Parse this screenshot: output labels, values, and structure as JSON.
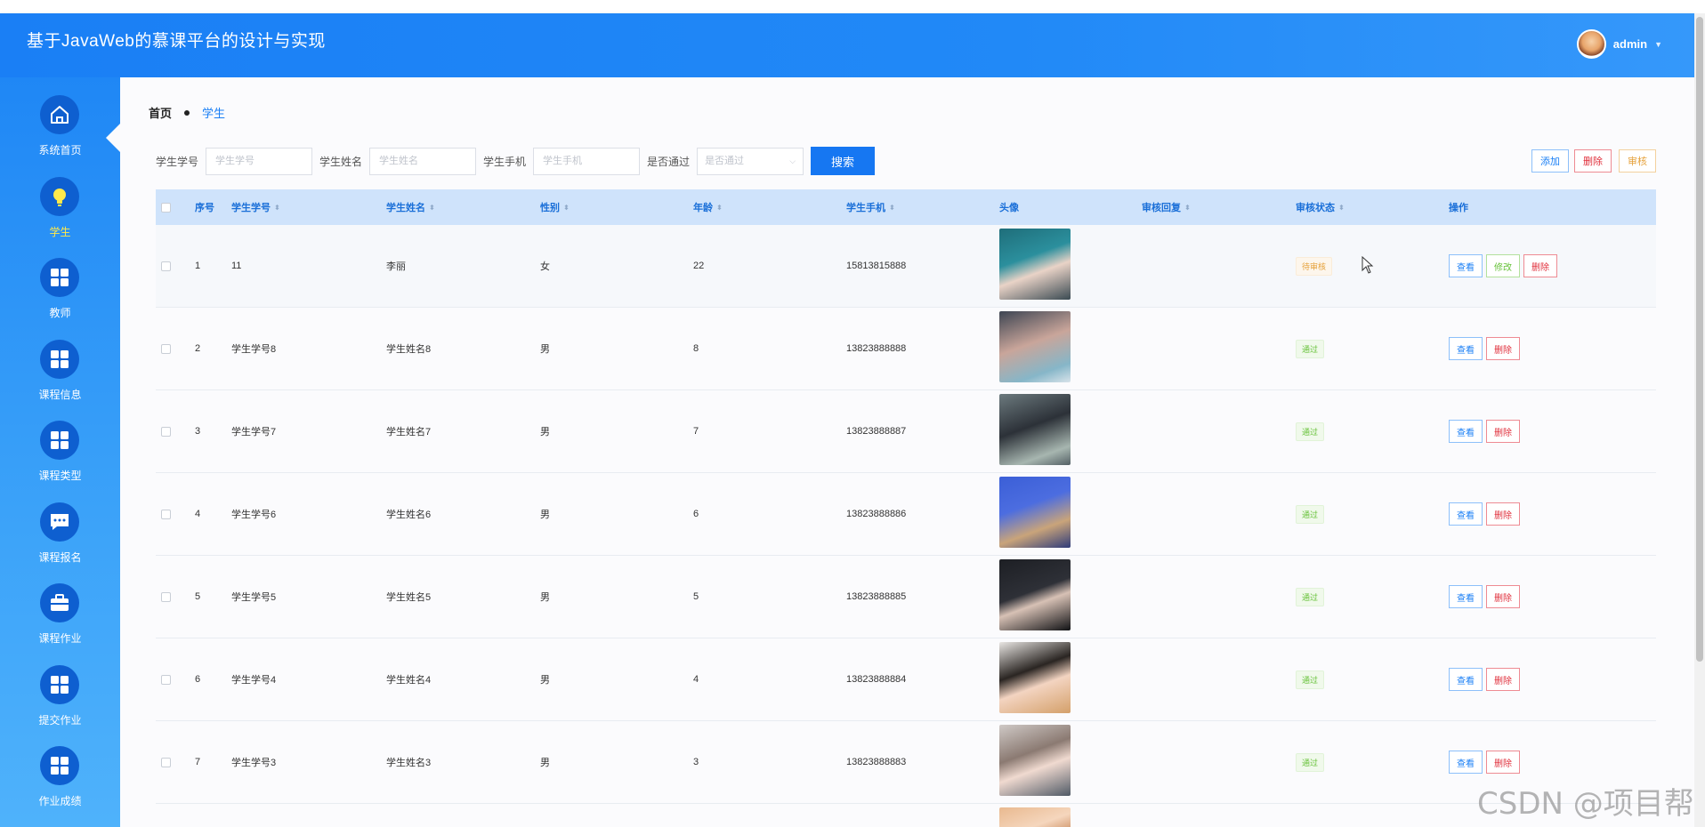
{
  "app": {
    "title": "基于JavaWeb的慕课平台的设计与实现",
    "user": "admin"
  },
  "sidebar": {
    "items": [
      {
        "label": "系统首页",
        "icon": "home-icon"
      },
      {
        "label": "学生",
        "icon": "lightbulb-icon",
        "active": true
      },
      {
        "label": "教师",
        "icon": "grid-icon"
      },
      {
        "label": "课程信息",
        "icon": "grid-icon"
      },
      {
        "label": "课程类型",
        "icon": "grid-icon"
      },
      {
        "label": "课程报名",
        "icon": "chat-icon"
      },
      {
        "label": "课程作业",
        "icon": "briefcase-icon"
      },
      {
        "label": "提交作业",
        "icon": "grid-icon"
      },
      {
        "label": "作业成绩",
        "icon": "grid-icon"
      }
    ]
  },
  "breadcrumb": {
    "home": "首页",
    "current": "学生"
  },
  "search": {
    "fields": [
      {
        "label": "学生学号",
        "placeholder": "学生学号"
      },
      {
        "label": "学生姓名",
        "placeholder": "学生姓名"
      },
      {
        "label": "学生手机",
        "placeholder": "学生手机"
      }
    ],
    "select": {
      "label": "是否通过",
      "placeholder": "是否通过"
    },
    "button": "搜索"
  },
  "toolbar": {
    "add": "添加",
    "delete": "删除",
    "audit": "审核"
  },
  "table": {
    "headers": {
      "index": "序号",
      "sno": "学生学号",
      "name": "学生姓名",
      "gender": "性别",
      "age": "年龄",
      "phone": "学生手机",
      "avatar": "头像",
      "reply": "审核回复",
      "status": "审核状态",
      "ops": "操作"
    },
    "actions": {
      "view": "查看",
      "edit": "修改",
      "delete": "删除"
    },
    "rows": [
      {
        "index": "1",
        "sno": "11",
        "name": "李丽",
        "gender": "女",
        "age": "22",
        "phone": "15813815888",
        "status": "待审核"
      },
      {
        "index": "2",
        "sno": "学生学号8",
        "name": "学生姓名8",
        "gender": "男",
        "age": "8",
        "phone": "13823888888",
        "status": "通过"
      },
      {
        "index": "3",
        "sno": "学生学号7",
        "name": "学生姓名7",
        "gender": "男",
        "age": "7",
        "phone": "13823888887",
        "status": "通过"
      },
      {
        "index": "4",
        "sno": "学生学号6",
        "name": "学生姓名6",
        "gender": "男",
        "age": "6",
        "phone": "13823888886",
        "status": "通过"
      },
      {
        "index": "5",
        "sno": "学生学号5",
        "name": "学生姓名5",
        "gender": "男",
        "age": "5",
        "phone": "13823888885",
        "status": "通过"
      },
      {
        "index": "6",
        "sno": "学生学号4",
        "name": "学生姓名4",
        "gender": "男",
        "age": "4",
        "phone": "13823888884",
        "status": "通过"
      },
      {
        "index": "7",
        "sno": "学生学号3",
        "name": "学生姓名3",
        "gender": "男",
        "age": "3",
        "phone": "13823888883",
        "status": "通过"
      }
    ]
  },
  "watermark": "CSDN @项目帮",
  "colors": {
    "primary": "#1677f2",
    "header": "#1a7ff5",
    "danger": "#e0303c",
    "warning": "#e6a23c",
    "success": "#67c23a"
  }
}
